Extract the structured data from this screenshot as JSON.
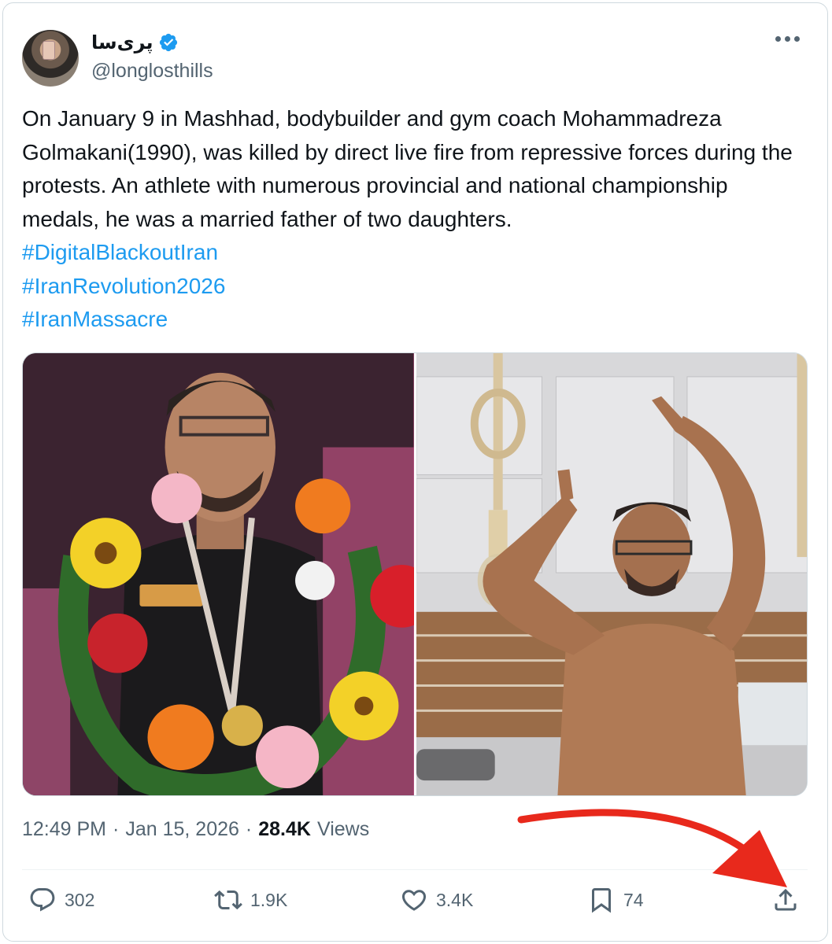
{
  "author": {
    "display_name": "پری‌سا",
    "handle": "@longlosthills",
    "verified_color": "#1d9bf0"
  },
  "tweet": {
    "body": "On January 9 in Mashhad, bodybuilder and gym coach Mohammadreza Golmakani(1990), was killed by direct live fire from repressive forces during the protests. An athlete with numerous provincial and national championship medals, he was a married father of two daughters.",
    "hashtags": [
      "#DigitalBlackoutIran",
      "#IranRevolution2026",
      "#IranMassacre"
    ],
    "time": "12:49 PM",
    "separator": "·",
    "date": "Jan 15, 2026",
    "views_count": "28.4K",
    "views_label": "Views"
  },
  "actions": {
    "reply_count": "302",
    "repost_count": "1.9K",
    "like_count": "3.4K",
    "bookmark_count": "74"
  },
  "icons": {
    "more": "more-horizontal-icon",
    "reply": "reply-icon",
    "repost": "repost-icon",
    "like": "heart-icon",
    "bookmark": "bookmark-icon",
    "share": "share-icon",
    "verified": "verified-badge-icon"
  },
  "colors": {
    "text": "#0f1419",
    "muted": "#536471",
    "link": "#1d9bf0",
    "annotation_arrow": "#e8291c"
  }
}
